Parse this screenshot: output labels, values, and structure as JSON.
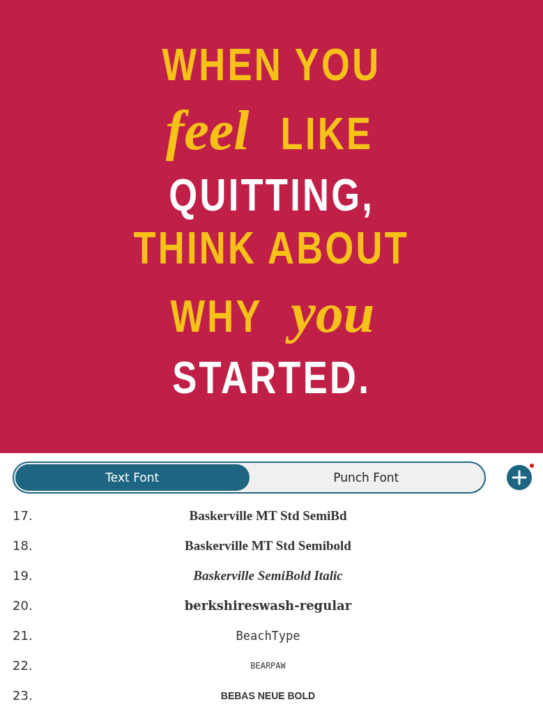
{
  "canvas": {
    "quote_lines": [
      [
        {
          "text": "WHEN YOU",
          "color": "#f6c21a",
          "kind": "block"
        }
      ],
      [
        {
          "text": "feel",
          "color": "#f6c21a",
          "kind": "script"
        },
        {
          "text": "LIKE",
          "color": "#f6c21a",
          "kind": "block"
        }
      ],
      [
        {
          "text": "QUITTING,",
          "color": "#ffffff",
          "kind": "block"
        }
      ],
      [
        {
          "text": "THINK ABOUT",
          "color": "#f6c21a",
          "kind": "block"
        }
      ],
      [
        {
          "text": "WHY",
          "color": "#f6c21a",
          "kind": "block"
        },
        {
          "text": "you",
          "color": "#f6c21a",
          "kind": "script"
        }
      ],
      [
        {
          "text": "STARTED.",
          "color": "#ffffff",
          "kind": "block"
        }
      ]
    ]
  },
  "tabs": [
    {
      "label": "Text Font",
      "selected": true
    },
    {
      "label": "Punch Font",
      "selected": false
    }
  ],
  "fonts": [
    {
      "number": "17.",
      "name": "Baskerville MT Std SemiBd",
      "kind": "serif-bold"
    },
    {
      "number": "18.",
      "name": "Baskerville MT Std Semibold",
      "kind": "serif-bold"
    },
    {
      "number": "19.",
      "name": "Baskerville SemiBold Italic",
      "kind": "serif-italic"
    },
    {
      "number": "20.",
      "name": "berkshireswash-regular",
      "kind": "decorative"
    },
    {
      "number": "21.",
      "name": "BeachType",
      "kind": "handwritten"
    },
    {
      "number": "22.",
      "name": "BEARPAW",
      "kind": "handwritten-small"
    },
    {
      "number": "23.",
      "name": "BEBAS NEUE BOLD",
      "kind": "condensed"
    }
  ]
}
